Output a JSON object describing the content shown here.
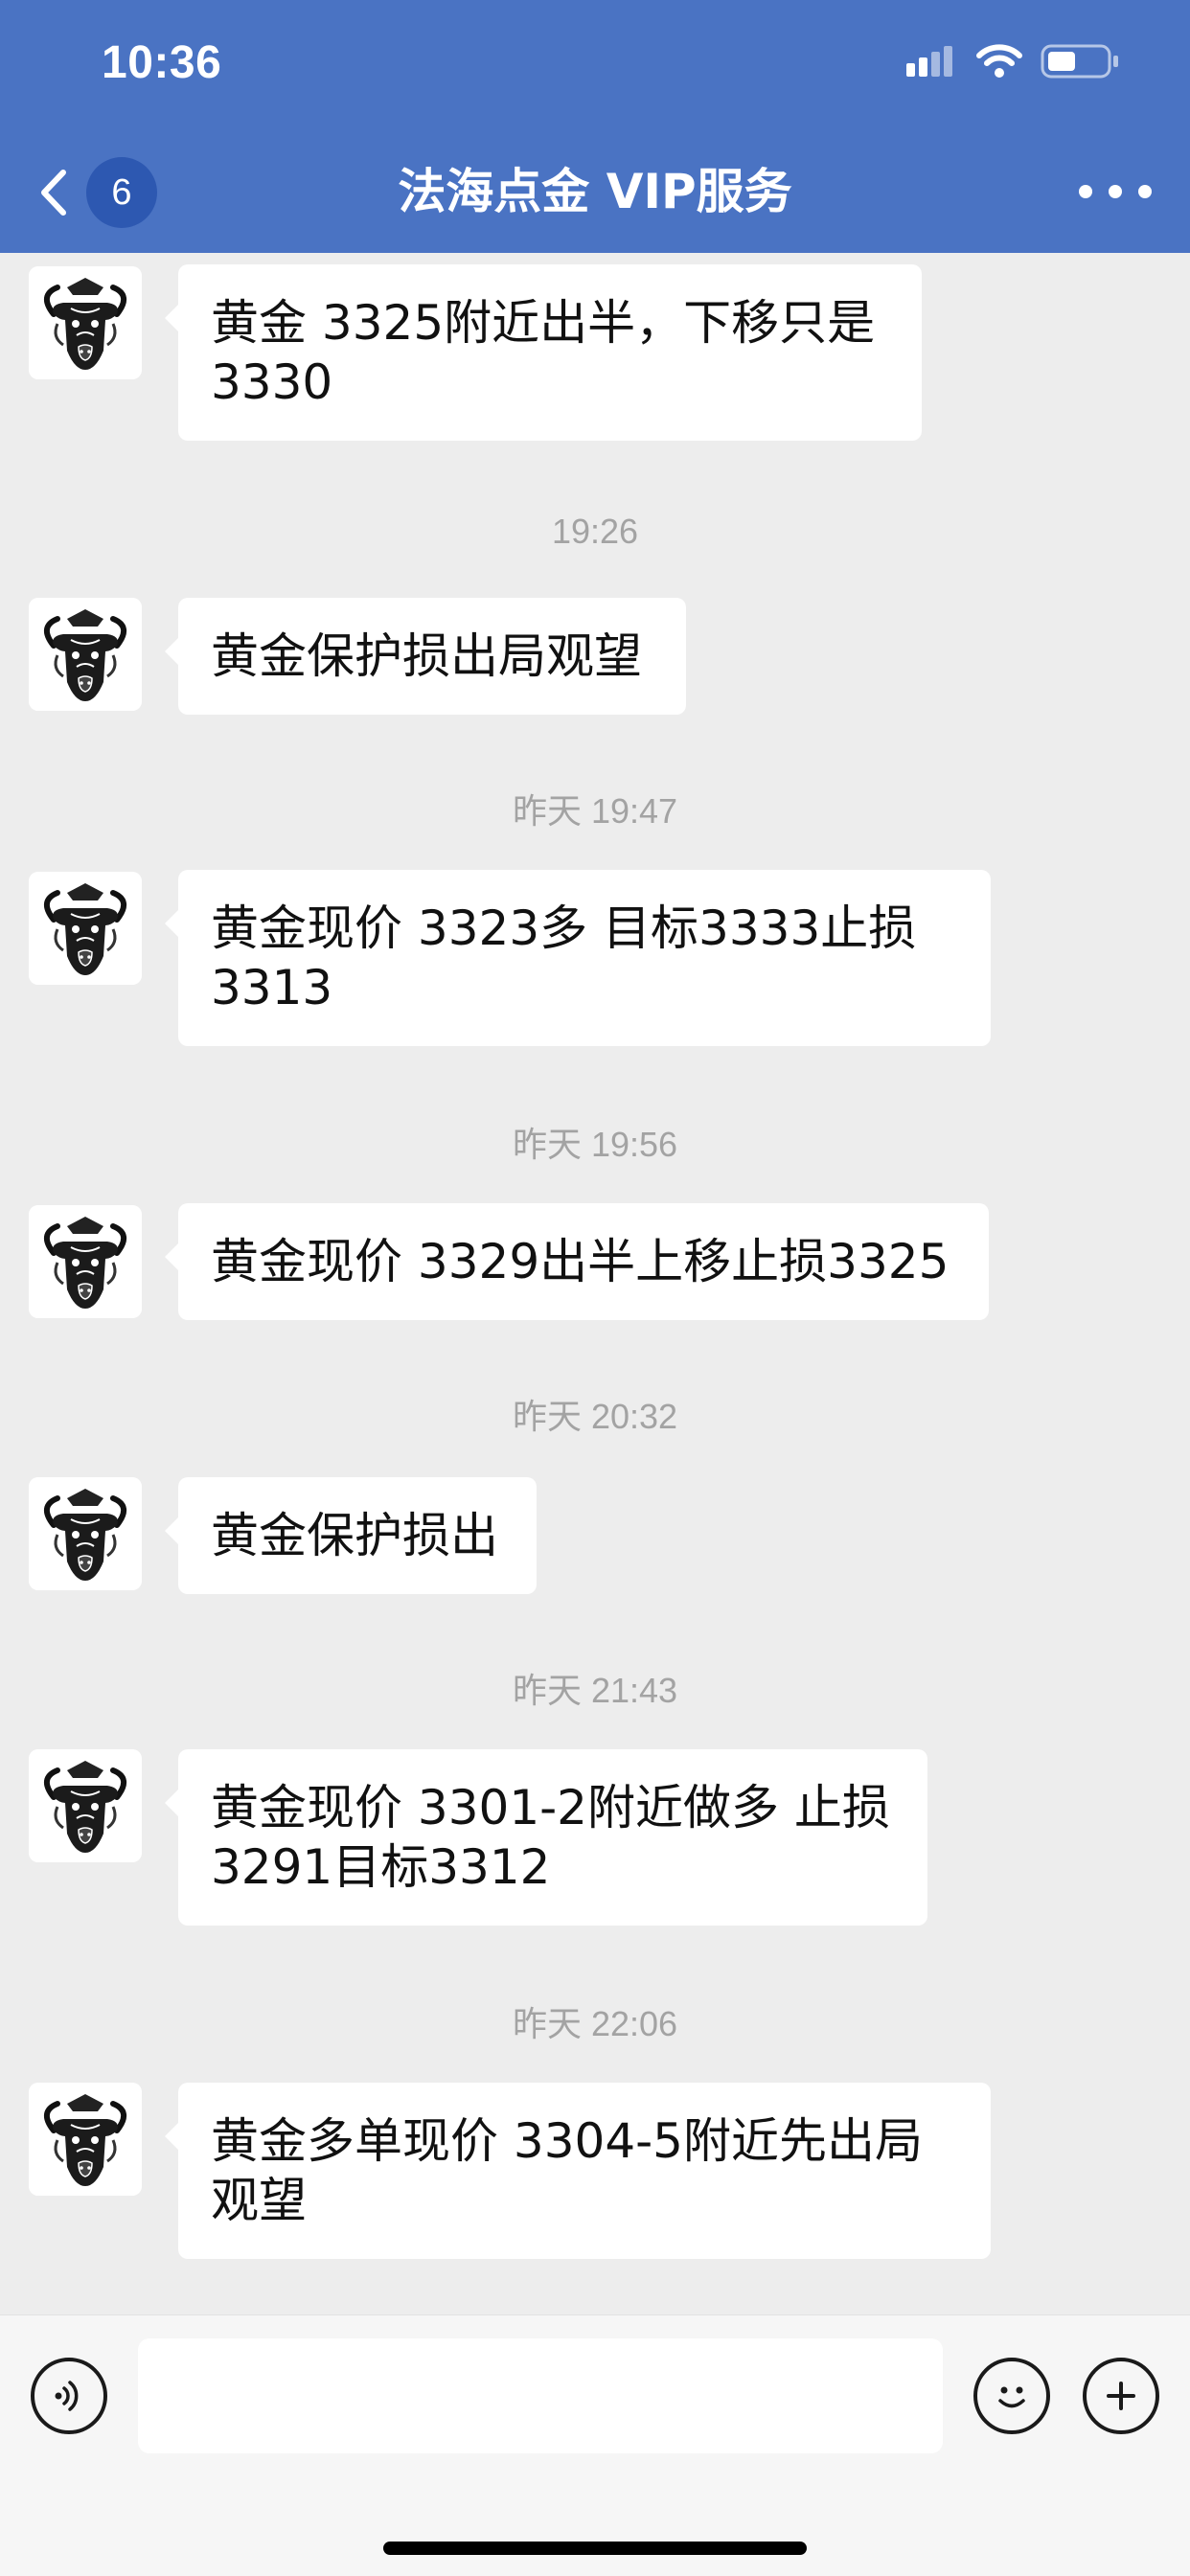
{
  "status_bar": {
    "time": "10:36"
  },
  "header": {
    "back_badge": "6",
    "title": "法海点金 VIP服务"
  },
  "messages": [
    {
      "timestamp": "",
      "text": "黄金 3325附近出半，下移只是3330"
    },
    {
      "timestamp": "19:26",
      "text": "黄金保护损出局观望"
    },
    {
      "timestamp": "昨天 19:47",
      "text": "黄金现价 3323多 目标3333止损3313"
    },
    {
      "timestamp": "昨天 19:56",
      "text": "黄金现价 3329出半上移止损3325"
    },
    {
      "timestamp": "昨天 20:32",
      "text": "黄金保护损出"
    },
    {
      "timestamp": "昨天 21:43",
      "text": "黄金现价 3301-2附近做多 止损3291目标3312"
    },
    {
      "timestamp": "昨天 22:06",
      "text": "黄金多单现价 3304-5附近先出局观望"
    }
  ],
  "input": {
    "placeholder": ""
  },
  "icons": {
    "back": "chevron-left-icon",
    "more": "more-dots-icon",
    "voice": "voice-icon",
    "emoji": "emoji-icon",
    "add": "plus-icon"
  },
  "colors": {
    "header_bg": "#4a73c3",
    "badge_bg": "#2d58b1",
    "chat_bg": "#ededed",
    "bubble_bg": "#ffffff"
  }
}
